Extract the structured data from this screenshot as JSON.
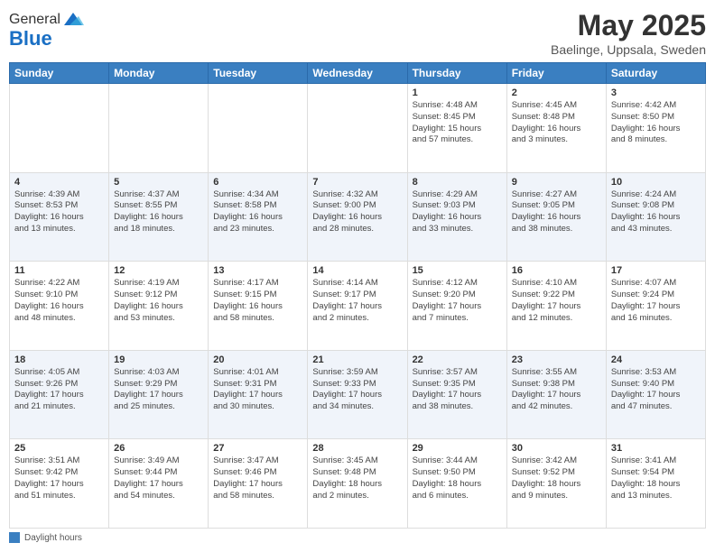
{
  "header": {
    "logo_general": "General",
    "logo_blue": "Blue",
    "month_title": "May 2025",
    "location": "Baelinge, Uppsala, Sweden"
  },
  "weekdays": [
    "Sunday",
    "Monday",
    "Tuesday",
    "Wednesday",
    "Thursday",
    "Friday",
    "Saturday"
  ],
  "legend": "Daylight hours",
  "weeks": [
    [
      {
        "day": "",
        "info": ""
      },
      {
        "day": "",
        "info": ""
      },
      {
        "day": "",
        "info": ""
      },
      {
        "day": "",
        "info": ""
      },
      {
        "day": "1",
        "info": "Sunrise: 4:48 AM\nSunset: 8:45 PM\nDaylight: 15 hours\nand 57 minutes."
      },
      {
        "day": "2",
        "info": "Sunrise: 4:45 AM\nSunset: 8:48 PM\nDaylight: 16 hours\nand 3 minutes."
      },
      {
        "day": "3",
        "info": "Sunrise: 4:42 AM\nSunset: 8:50 PM\nDaylight: 16 hours\nand 8 minutes."
      }
    ],
    [
      {
        "day": "4",
        "info": "Sunrise: 4:39 AM\nSunset: 8:53 PM\nDaylight: 16 hours\nand 13 minutes."
      },
      {
        "day": "5",
        "info": "Sunrise: 4:37 AM\nSunset: 8:55 PM\nDaylight: 16 hours\nand 18 minutes."
      },
      {
        "day": "6",
        "info": "Sunrise: 4:34 AM\nSunset: 8:58 PM\nDaylight: 16 hours\nand 23 minutes."
      },
      {
        "day": "7",
        "info": "Sunrise: 4:32 AM\nSunset: 9:00 PM\nDaylight: 16 hours\nand 28 minutes."
      },
      {
        "day": "8",
        "info": "Sunrise: 4:29 AM\nSunset: 9:03 PM\nDaylight: 16 hours\nand 33 minutes."
      },
      {
        "day": "9",
        "info": "Sunrise: 4:27 AM\nSunset: 9:05 PM\nDaylight: 16 hours\nand 38 minutes."
      },
      {
        "day": "10",
        "info": "Sunrise: 4:24 AM\nSunset: 9:08 PM\nDaylight: 16 hours\nand 43 minutes."
      }
    ],
    [
      {
        "day": "11",
        "info": "Sunrise: 4:22 AM\nSunset: 9:10 PM\nDaylight: 16 hours\nand 48 minutes."
      },
      {
        "day": "12",
        "info": "Sunrise: 4:19 AM\nSunset: 9:12 PM\nDaylight: 16 hours\nand 53 minutes."
      },
      {
        "day": "13",
        "info": "Sunrise: 4:17 AM\nSunset: 9:15 PM\nDaylight: 16 hours\nand 58 minutes."
      },
      {
        "day": "14",
        "info": "Sunrise: 4:14 AM\nSunset: 9:17 PM\nDaylight: 17 hours\nand 2 minutes."
      },
      {
        "day": "15",
        "info": "Sunrise: 4:12 AM\nSunset: 9:20 PM\nDaylight: 17 hours\nand 7 minutes."
      },
      {
        "day": "16",
        "info": "Sunrise: 4:10 AM\nSunset: 9:22 PM\nDaylight: 17 hours\nand 12 minutes."
      },
      {
        "day": "17",
        "info": "Sunrise: 4:07 AM\nSunset: 9:24 PM\nDaylight: 17 hours\nand 16 minutes."
      }
    ],
    [
      {
        "day": "18",
        "info": "Sunrise: 4:05 AM\nSunset: 9:26 PM\nDaylight: 17 hours\nand 21 minutes."
      },
      {
        "day": "19",
        "info": "Sunrise: 4:03 AM\nSunset: 9:29 PM\nDaylight: 17 hours\nand 25 minutes."
      },
      {
        "day": "20",
        "info": "Sunrise: 4:01 AM\nSunset: 9:31 PM\nDaylight: 17 hours\nand 30 minutes."
      },
      {
        "day": "21",
        "info": "Sunrise: 3:59 AM\nSunset: 9:33 PM\nDaylight: 17 hours\nand 34 minutes."
      },
      {
        "day": "22",
        "info": "Sunrise: 3:57 AM\nSunset: 9:35 PM\nDaylight: 17 hours\nand 38 minutes."
      },
      {
        "day": "23",
        "info": "Sunrise: 3:55 AM\nSunset: 9:38 PM\nDaylight: 17 hours\nand 42 minutes."
      },
      {
        "day": "24",
        "info": "Sunrise: 3:53 AM\nSunset: 9:40 PM\nDaylight: 17 hours\nand 47 minutes."
      }
    ],
    [
      {
        "day": "25",
        "info": "Sunrise: 3:51 AM\nSunset: 9:42 PM\nDaylight: 17 hours\nand 51 minutes."
      },
      {
        "day": "26",
        "info": "Sunrise: 3:49 AM\nSunset: 9:44 PM\nDaylight: 17 hours\nand 54 minutes."
      },
      {
        "day": "27",
        "info": "Sunrise: 3:47 AM\nSunset: 9:46 PM\nDaylight: 17 hours\nand 58 minutes."
      },
      {
        "day": "28",
        "info": "Sunrise: 3:45 AM\nSunset: 9:48 PM\nDaylight: 18 hours\nand 2 minutes."
      },
      {
        "day": "29",
        "info": "Sunrise: 3:44 AM\nSunset: 9:50 PM\nDaylight: 18 hours\nand 6 minutes."
      },
      {
        "day": "30",
        "info": "Sunrise: 3:42 AM\nSunset: 9:52 PM\nDaylight: 18 hours\nand 9 minutes."
      },
      {
        "day": "31",
        "info": "Sunrise: 3:41 AM\nSunset: 9:54 PM\nDaylight: 18 hours\nand 13 minutes."
      }
    ]
  ]
}
